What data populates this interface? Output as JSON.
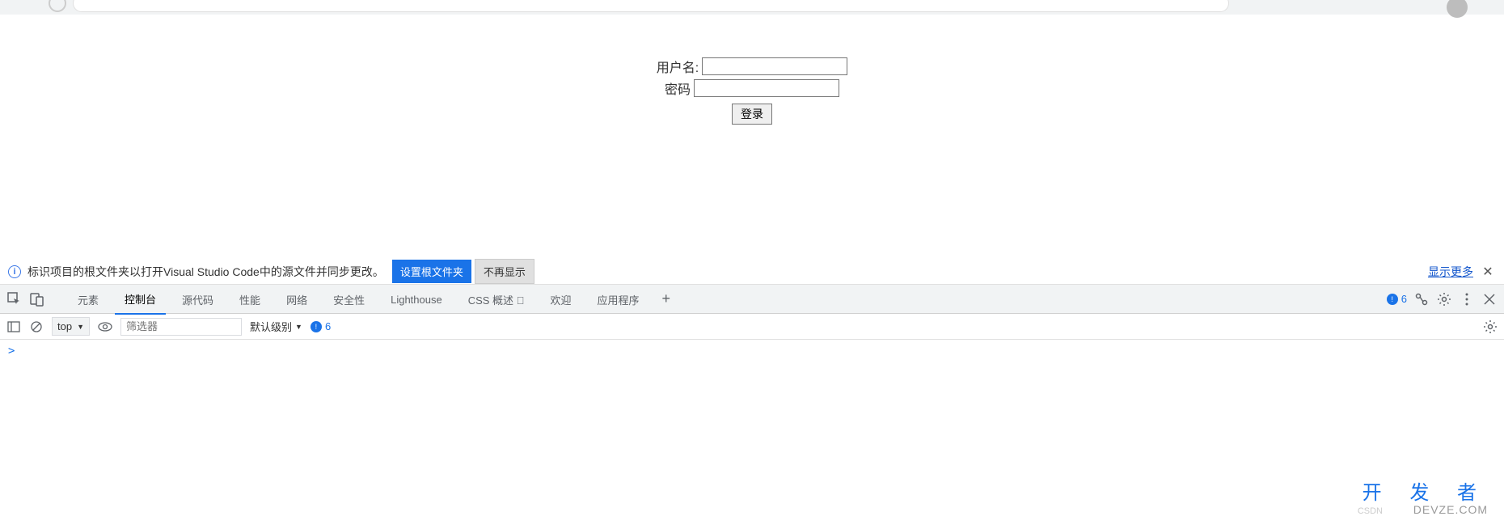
{
  "login": {
    "username_label": "用户名:",
    "password_label": "密码",
    "submit_label": "登录"
  },
  "infobar": {
    "message": "标识项目的根文件夹以打开Visual Studio Code中的源文件并同步更改。",
    "primary_btn": "设置根文件夹",
    "secondary_btn": "不再显示",
    "show_more": "显示更多"
  },
  "devtools": {
    "tabs": [
      "元素",
      "控制台",
      "源代码",
      "性能",
      "网络",
      "安全性",
      "Lighthouse",
      "CSS 概述 ⃤",
      "欢迎",
      "应用程序"
    ],
    "active_tab": "控制台",
    "issue_count": "6"
  },
  "console": {
    "context": "top",
    "filter_placeholder": "筛选器",
    "level_label": "默认级别",
    "issues": "6",
    "prompt": ">"
  },
  "watermark": {
    "top": "开 发 者",
    "bottom": "DEVZE.COM",
    "csdn": "CSDN"
  }
}
